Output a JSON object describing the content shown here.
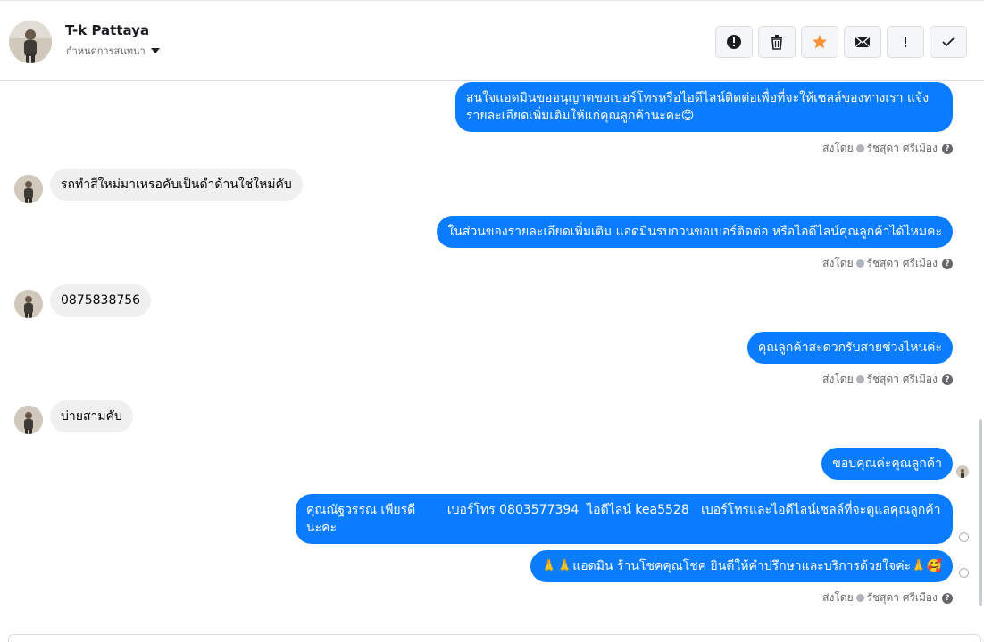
{
  "header": {
    "contact_name": "T-k Pattaya",
    "assign_label": "กำหนดการสนทนา",
    "toolbar": [
      {
        "name": "report-icon",
        "label": "Report"
      },
      {
        "name": "trash-icon",
        "label": "Delete"
      },
      {
        "name": "star-icon",
        "label": "Star"
      },
      {
        "name": "mail-icon",
        "label": "Mark unread"
      },
      {
        "name": "exclaim-icon",
        "label": "!"
      },
      {
        "name": "check-icon",
        "label": "Done"
      }
    ]
  },
  "thread": {
    "sent_by_prefix": "ส่งโดย",
    "sender_name": "รัชสุดา ศรีเมือง",
    "messages": [
      {
        "from": "page",
        "text": "สนใจแอดมินขออนุญาตขอเบอร์โทรหรือไอดีไลน์ติดต่อเพื่อที่จะให้เซลล์ของทางเรา แจ้งรายละเอียดเพิ่มเติมให้แก่คุณลูกค้านะคะ😊"
      },
      {
        "from": "customer",
        "text": "รถทำสีใหม่มาเหรอคับเป็นดำด้านใช่ใหม่คับ"
      },
      {
        "from": "page",
        "text": "ในส่วนของรายละเอียดเพิ่มเติม แอดมินรบกวนขอเบอร์ติดต่อ หรือไอดีไลน์คุณลูกค้าได้ไหมคะ"
      },
      {
        "from": "customer",
        "text": "0875838756"
      },
      {
        "from": "page",
        "text": "คุณลูกค้าสะดวกรับสายช่วงไหนค่ะ"
      },
      {
        "from": "customer",
        "text": "บ่ายสามคับ"
      },
      {
        "from": "page",
        "text": "ขอบคุณค่ะคุณลูกค้า"
      },
      {
        "from": "page",
        "text": "คุณณัฐวรรณ เพียรดี        เบอร์โทร 0803577394  ไอดีไลน์ kea5528   เบอร์โทรและไอดีไลน์เซลล์ที่จะดูแลคุณลูกค้านะคะ"
      },
      {
        "from": "page",
        "text": "🙏🙏แอดมิน ร้านโชคคุณโชค ยินดีให้คำปรึกษาและบริการด้วยใจค่ะ🙏🥰"
      }
    ]
  }
}
